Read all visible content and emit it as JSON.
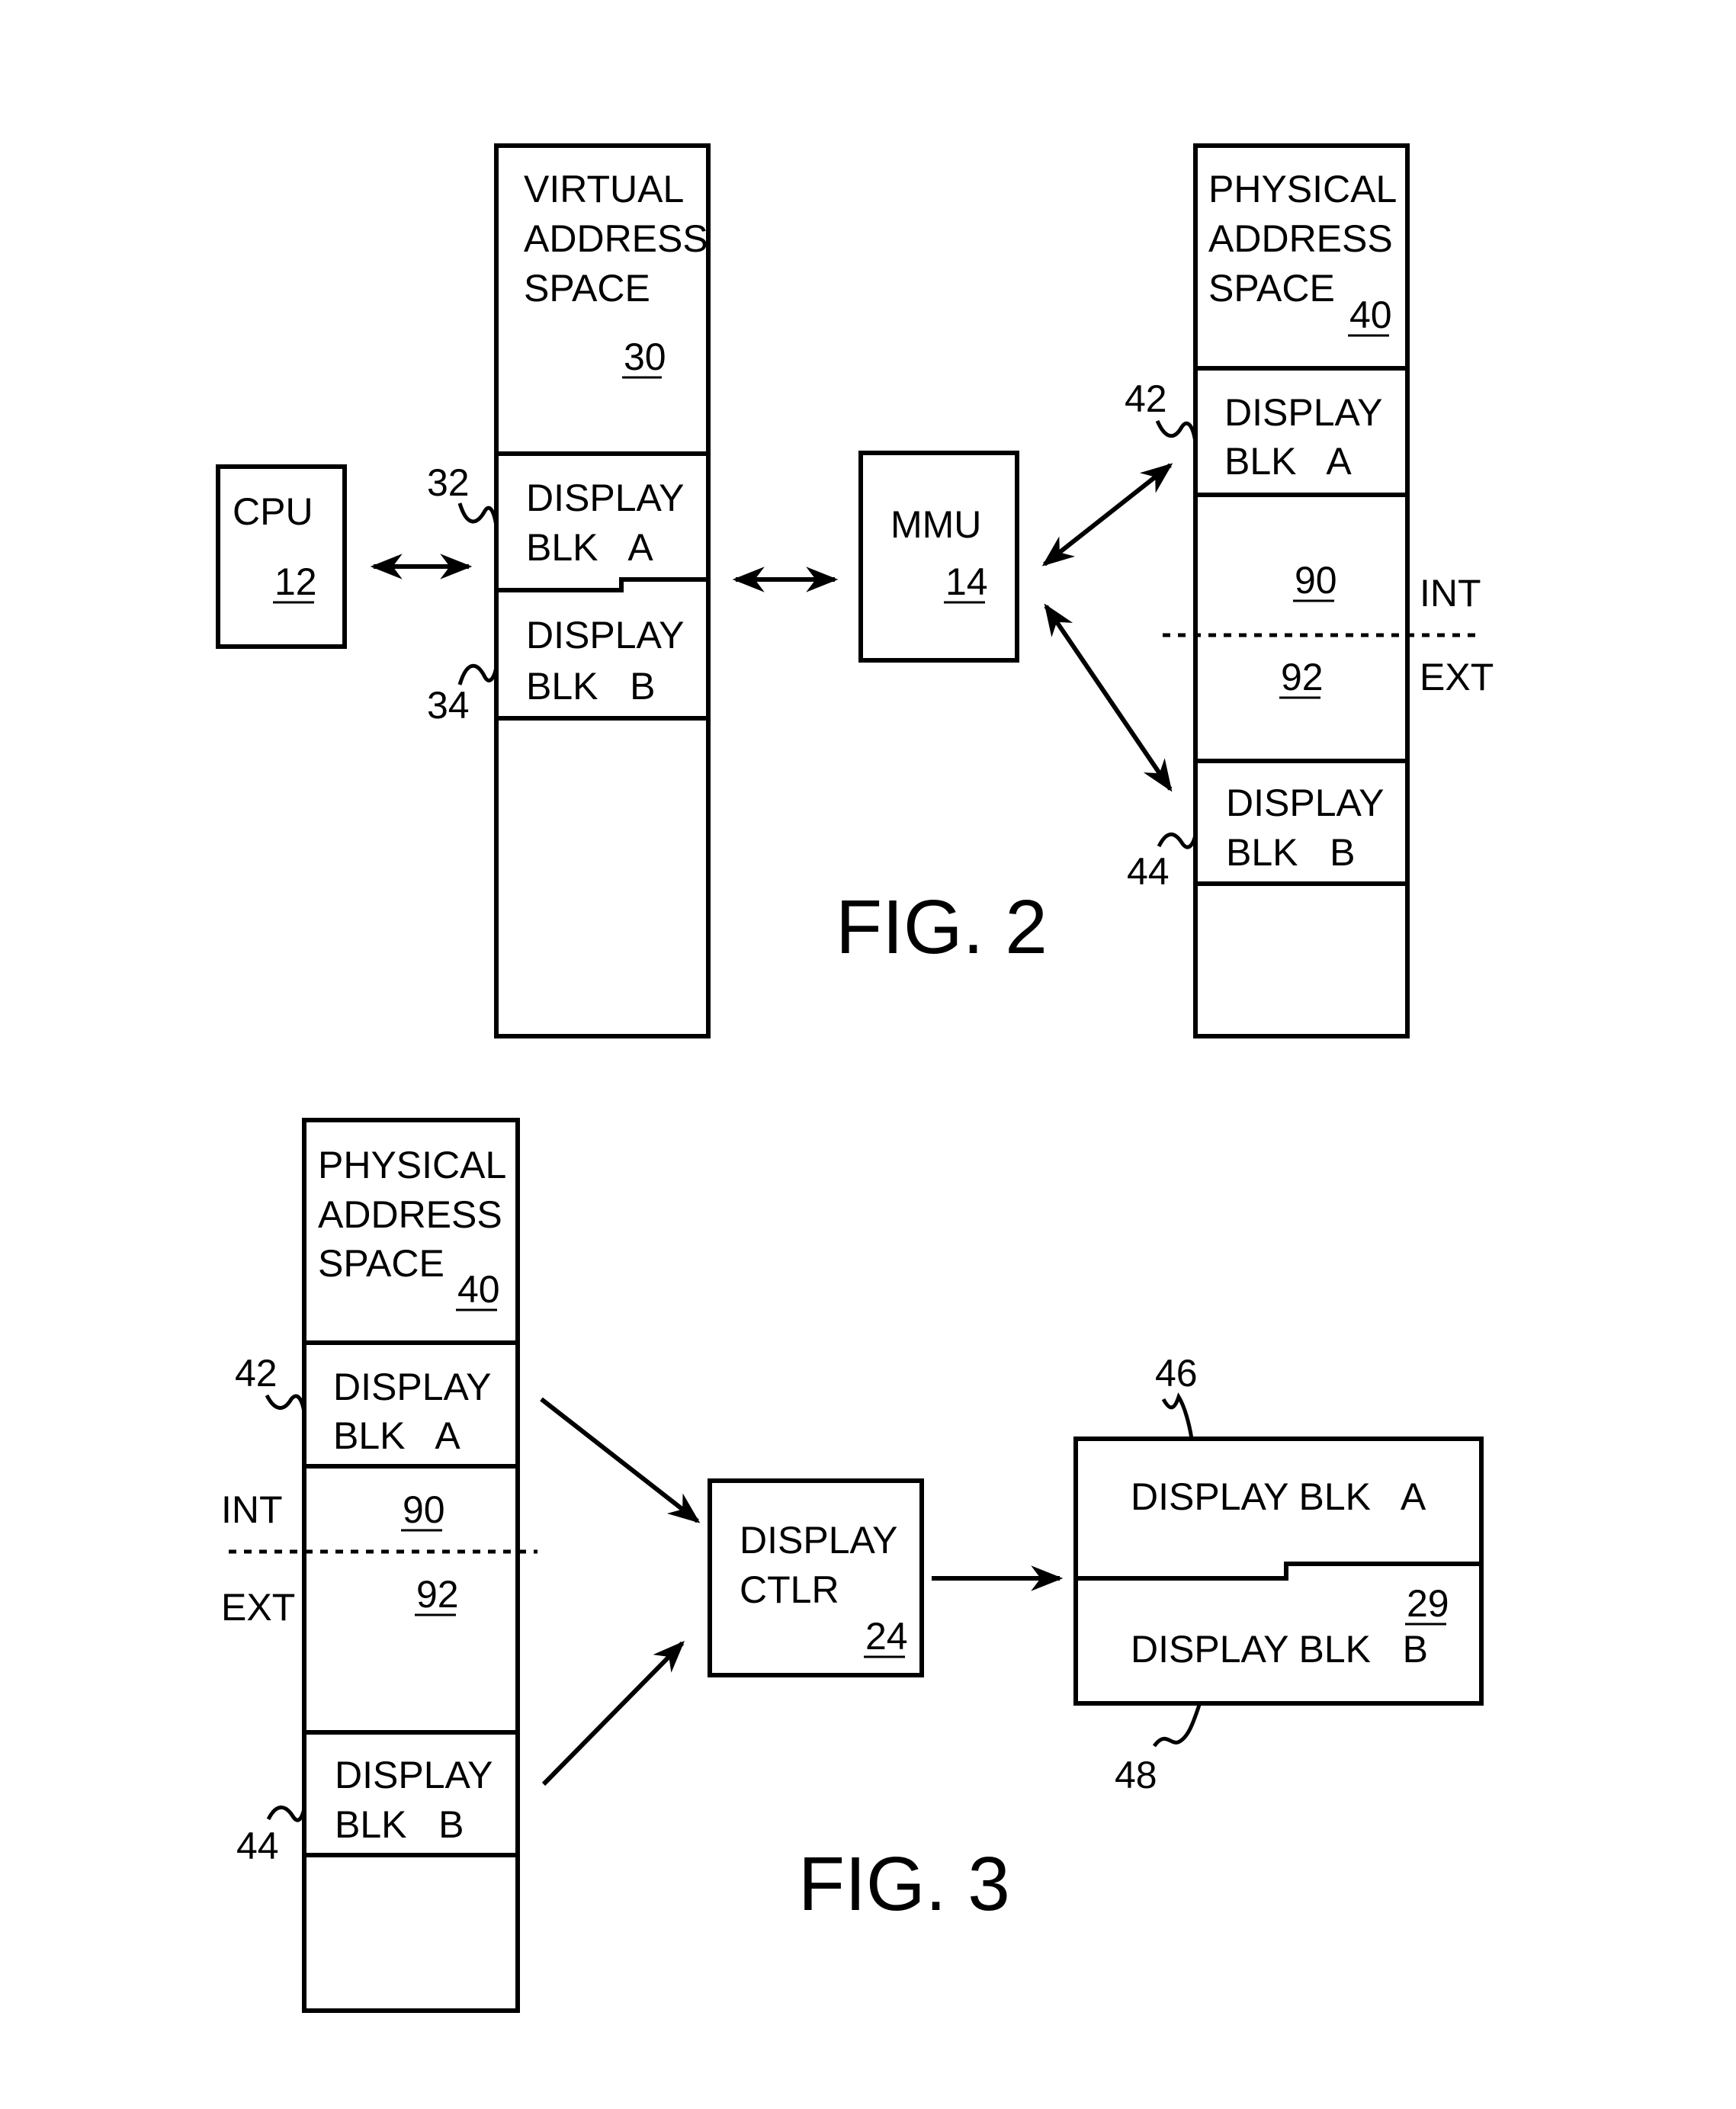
{
  "fig2": {
    "caption": "FIG. 2",
    "cpu": {
      "label": "CPU",
      "ref": "12"
    },
    "virtual": {
      "line1": "VIRTUAL",
      "line2": "ADDRESS",
      "line3": "SPACE",
      "ref": "30",
      "blk_a": {
        "line1": "DISPLAY",
        "line2": "BLK   A",
        "ref": "32"
      },
      "blk_b": {
        "line1": "DISPLAY",
        "line2": "BLK   B",
        "ref": "34"
      }
    },
    "mmu": {
      "label": "MMU",
      "ref": "14"
    },
    "physical": {
      "line1": "PHYSICAL",
      "line2": "ADDRESS",
      "line3": "SPACE",
      "ref": "40",
      "blk_a": {
        "line1": "DISPLAY",
        "line2": "BLK   A",
        "ref": "42"
      },
      "int_ref": "90",
      "ext_ref": "92",
      "int_label": "INT",
      "ext_label": "EXT",
      "blk_b": {
        "line1": "DISPLAY",
        "line2": "BLK   B",
        "ref": "44"
      }
    }
  },
  "fig3": {
    "caption": "FIG. 3",
    "physical": {
      "line1": "PHYSICAL",
      "line2": "ADDRESS",
      "line3": "SPACE",
      "ref": "40",
      "blk_a": {
        "line1": "DISPLAY",
        "line2": "BLK   A",
        "ref": "42"
      },
      "int_ref": "90",
      "ext_ref": "92",
      "int_label": "INT",
      "ext_label": "EXT",
      "blk_b": {
        "line1": "DISPLAY",
        "line2": "BLK   B",
        "ref": "44"
      }
    },
    "ctlr": {
      "line1": "DISPLAY",
      "line2": "CTLR",
      "ref": "24"
    },
    "screen": {
      "blk_a": "DISPLAY BLK   A",
      "blk_b": "DISPLAY BLK   B",
      "ref": "29",
      "ref_a": "46",
      "ref_b": "48"
    }
  }
}
